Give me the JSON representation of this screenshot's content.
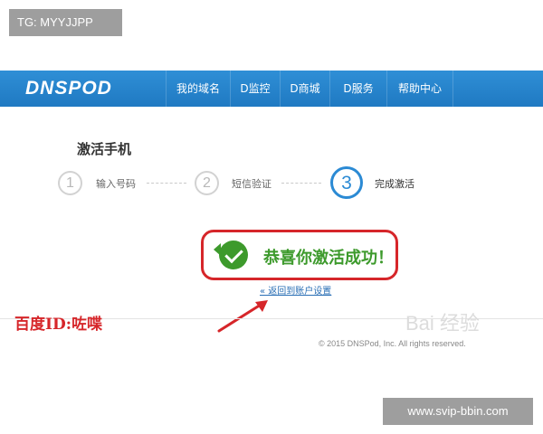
{
  "tg_badge": "TG: MYYJJPP",
  "logo": "DNSPOD",
  "nav": [
    "我的域名",
    "D监控",
    "D商城",
    "D服务",
    "帮助中心"
  ],
  "page_title": "激活手机",
  "steps": [
    {
      "num": "1",
      "label": "输入号码",
      "active": false
    },
    {
      "num": "2",
      "label": "短信验证",
      "active": false
    },
    {
      "num": "3",
      "label": "完成激活",
      "active": true
    }
  ],
  "success_message": "恭喜你激活成功！",
  "back_link": "« 返回到账户设置",
  "annotation": "百度ID:咗喋",
  "watermark": "Bai 经验",
  "copyright": "© 2015 DNSPod, Inc. All rights reserved.",
  "url_badge": "www.svip-bbin.com",
  "colors": {
    "brand": "#1f79c2",
    "success": "#3d9a2c",
    "highlight": "#d6262a",
    "active_step": "#2b8ad4"
  }
}
